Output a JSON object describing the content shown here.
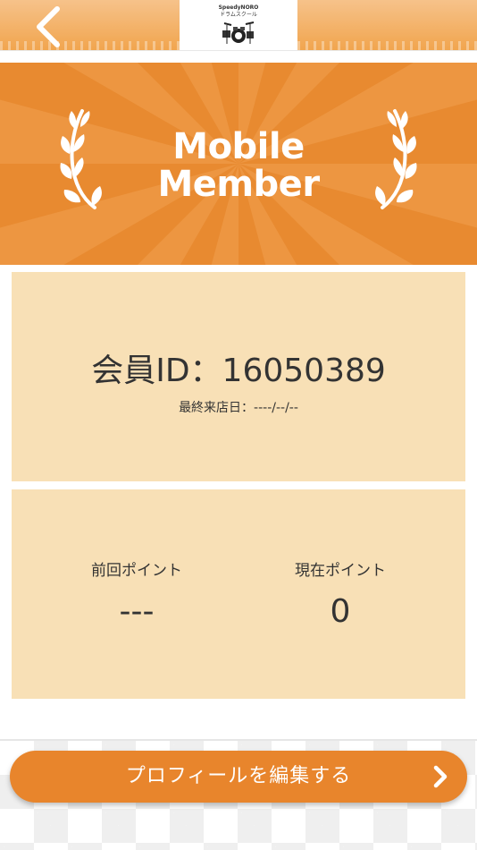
{
  "header": {
    "back_icon": "chevron-left-icon",
    "logo": {
      "line1": "SpeedyNORO",
      "line2": "ドラムスクール",
      "image": "drum-kit-icon"
    },
    "colors": {
      "bar": "#f1a54e"
    }
  },
  "banner": {
    "title_line1": "Mobile",
    "title_line2": "Member",
    "decoration": "laurel-icon",
    "colors": {
      "background": "#e88a30",
      "rays": "#f0a050",
      "text": "#ffffff"
    }
  },
  "member": {
    "id_text": "会員ID：16050389",
    "last_visit_text": "最終来店日：----/--/--"
  },
  "points": {
    "previous_label": "前回ポイント",
    "previous_value": "---",
    "current_label": "現在ポイント",
    "current_value": "0"
  },
  "footer": {
    "edit_profile_label": "プロフィールを編集する",
    "chevron_icon": "chevron-right-icon",
    "colors": {
      "button": "#e8852c",
      "card": "#f8e0b6"
    }
  }
}
